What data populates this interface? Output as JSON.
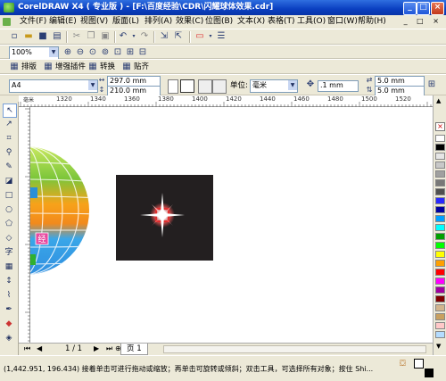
{
  "window": {
    "title": "CorelDRAW X4 ( 专业版 ) - [F:\\百度经验\\CDR\\闪耀球体效果.cdr]"
  },
  "menu": [
    "文件(F)",
    "编辑(E)",
    "视图(V)",
    "版面(L)",
    "排列(A)",
    "效果(C)",
    "位图(B)",
    "文本(X)",
    "表格(T)",
    "工具(O)",
    "窗口(W)",
    "帮助(H)"
  ],
  "zoom": {
    "value": "100%"
  },
  "plugins": {
    "typeset": "排版",
    "enhance": "增强插件",
    "convert": "转换",
    "tile": "贴齐"
  },
  "property_bar": {
    "paper": "A4",
    "width": "297.0 mm",
    "height": "210.0 mm",
    "units_label": "单位:",
    "units": "毫米",
    "nudge": ".1 mm",
    "dup_x": "5.0 mm",
    "dup_y": "5.0 mm"
  },
  "ruler": {
    "h_ticks": [
      "1320",
      "1340",
      "1360",
      "1380",
      "1400",
      "1420",
      "1440",
      "1460",
      "1480",
      "1500",
      "1520"
    ],
    "v_label": "毫米"
  },
  "pager": {
    "position": "1 / 1",
    "tab": "页 1"
  },
  "status": {
    "text": "(1,442.951, 196.434) 接着单击可进行拖动或缩放；再单击可旋转或倾斜；双击工具，可选择所有对象；按住 Shi..."
  },
  "ball_labels": {
    "badge": "经"
  },
  "palette": [
    "#ffffff",
    "#000000",
    "#e6e6e6",
    "#c8c8c8",
    "#a0a0a0",
    "#787878",
    "#505050",
    "#2828ff",
    "#0000a0",
    "#00a0ff",
    "#00ffff",
    "#00a000",
    "#00ff00",
    "#ffff00",
    "#ffa000",
    "#ff0000",
    "#ff00ff",
    "#a000a0",
    "#800000",
    "#d2b48c",
    "#c8a060",
    "#ffc8c8",
    "#b4dcff"
  ]
}
